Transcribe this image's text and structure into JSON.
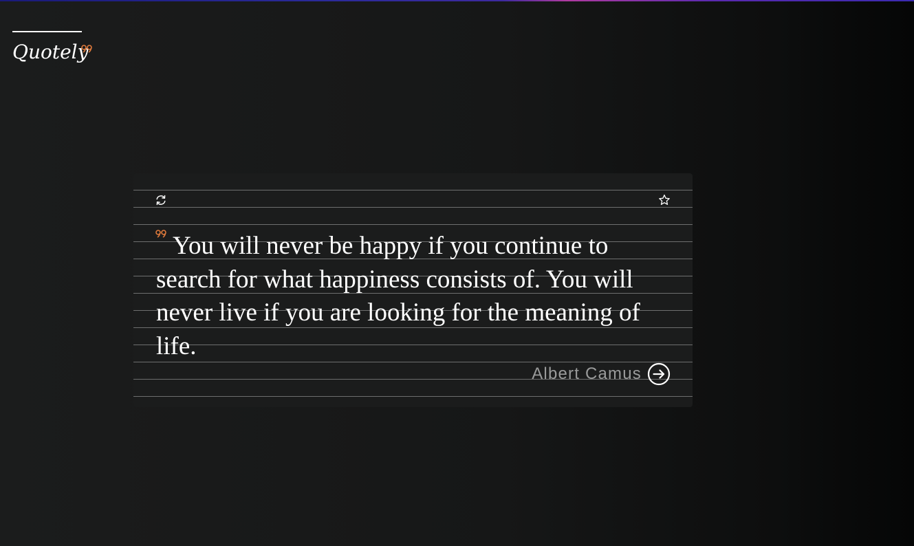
{
  "app": {
    "logo_text": "Quotely",
    "accent_color": "#e07a3c"
  },
  "quote": {
    "text": "You will never be happy if you continue to search for what happiness consists of. You will never live if you are looking for the meaning of life.",
    "author": "Albert Camus"
  },
  "icons": {
    "refresh": "refresh-icon",
    "favorite": "star-icon",
    "quote_mark": "quote-mark-icon",
    "author_link": "arrow-right-circle-icon"
  }
}
